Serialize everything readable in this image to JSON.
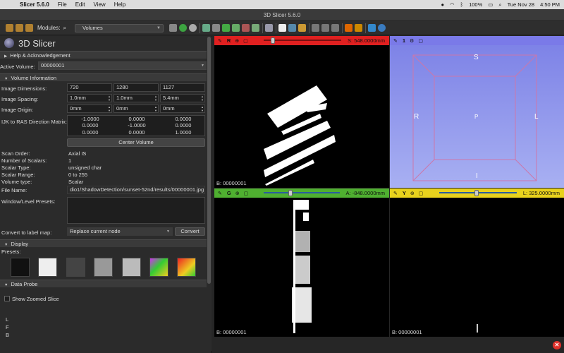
{
  "menubar": {
    "app_name": "Slicer 5.6.0",
    "items": [
      "File",
      "Edit",
      "View",
      "Help"
    ],
    "battery": "100%",
    "date": "Tue Nov 28",
    "time": "4:50 PM"
  },
  "window": {
    "title": "3D Slicer 5.6.0"
  },
  "toolbar": {
    "modules_label": "Modules:",
    "module_value": "Volumes"
  },
  "panel": {
    "logo_text": "3D Slicer",
    "help_section": "Help & Acknowledgement",
    "active_volume_label": "Active Volume:",
    "active_volume_value": "00000001",
    "volume_info_section": "Volume Information",
    "image_dimensions_label": "Image Dimensions:",
    "dimensions": [
      "720",
      "1280",
      "1127"
    ],
    "image_spacing_label": "Image Spacing:",
    "spacing": [
      "1.0mm",
      "1.0mm",
      "5.4mm"
    ],
    "image_origin_label": "Image Origin:",
    "origin": [
      "0mm",
      "0mm",
      "0mm"
    ],
    "ijk_label": "IJK to RAS Direction Matrix:",
    "matrix": [
      [
        "-1.0000",
        "0.0000",
        "0.0000"
      ],
      [
        "0.0000",
        "-1.0000",
        "0.0000"
      ],
      [
        "0.0000",
        "0.0000",
        "1.0000"
      ]
    ],
    "center_volume_button": "Center Volume",
    "scan_order_label": "Scan Order:",
    "scan_order": "Axial IS",
    "num_scalars_label": "Number of Scalars:",
    "num_scalars": "1",
    "scalar_type_label": "Scalar Type:",
    "scalar_type": "unsigned char",
    "scalar_range_label": "Scalar Range:",
    "scalar_range": "0 to 255",
    "volume_type_label": "Volume type:",
    "volume_type": "Scalar",
    "file_name_label": "File Name:",
    "file_name": "dio1/ShadowDetection/sunset-52nd/results/00000001.jpg",
    "wl_presets_label": "Window/Level Presets:",
    "convert_label": "Convert to label map:",
    "convert_option": "Replace current node",
    "convert_button": "Convert",
    "display_section": "Display",
    "presets_label": "Presets:",
    "data_probe_section": "Data Probe",
    "show_zoomed_slice": "Show Zoomed Slice",
    "probe_rows": [
      "L",
      "F",
      "B"
    ]
  },
  "views": {
    "red": {
      "name": "R",
      "value": "S: 548.0000mm",
      "corner": "B: 00000001",
      "color": "#e02020"
    },
    "threed": {
      "name": "1",
      "color": "#7a7ae8",
      "labels": {
        "top": "S",
        "left": "R",
        "right": "L",
        "center": "P",
        "bottom": "I"
      }
    },
    "green": {
      "name": "G",
      "value": "A: -848.0000mm",
      "corner": "B: 00000001",
      "color": "#4fb030"
    },
    "yellow": {
      "name": "Y",
      "value": "L: 325.0000mm",
      "corner": "B: 00000001",
      "color": "#e8d21d"
    }
  }
}
